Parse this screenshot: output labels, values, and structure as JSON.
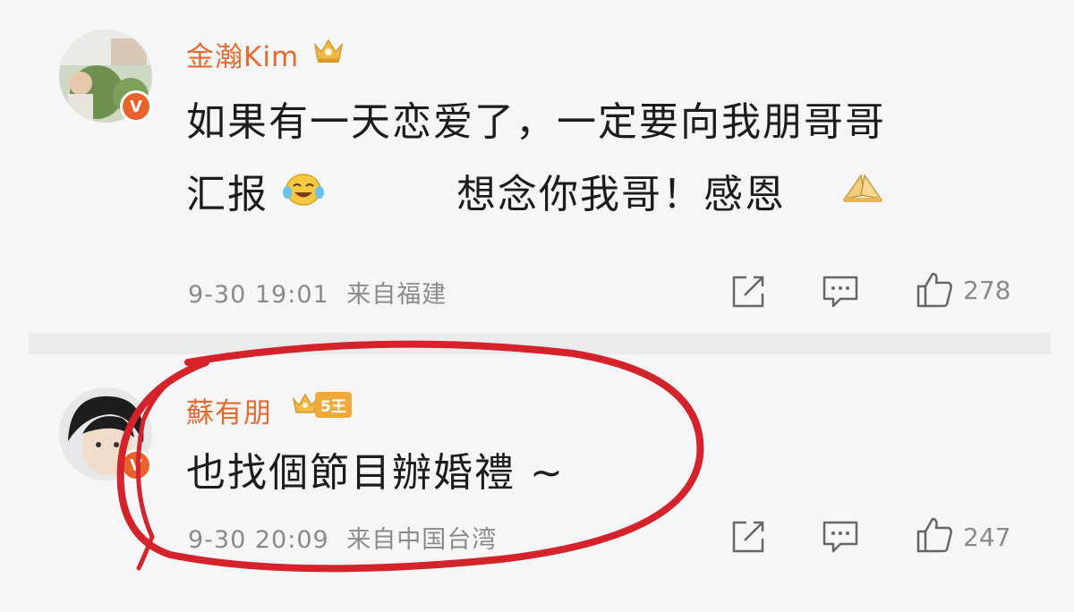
{
  "colors": {
    "username": "#e36b2f",
    "badge": "#e8622c",
    "gold": "#e6a83a",
    "circle": "#d4232b"
  },
  "posts": [
    {
      "username": "金瀚Kim",
      "content_line1": "如果有一天恋爱了，一定要向我朋哥哥",
      "content_line2a": "汇报",
      "content_line2b": "想念你我哥！感恩",
      "time": "9-30 19:01",
      "source": "来自福建",
      "likes": "278",
      "badge": "V",
      "icons": [
        "crown-icon",
        "laugh-cry-emoji",
        "pray-emoji",
        "share-icon",
        "comment-icon",
        "like-icon"
      ]
    },
    {
      "username": "蘇有朋",
      "user_tag": "5王",
      "content": "也找個節目辦婚禮 ~",
      "time": "9-30 20:09",
      "source": "来自中国台湾",
      "likes": "247",
      "badge": "V",
      "icons": [
        "crown-tag-icon",
        "share-icon",
        "comment-icon",
        "like-icon"
      ]
    }
  ]
}
